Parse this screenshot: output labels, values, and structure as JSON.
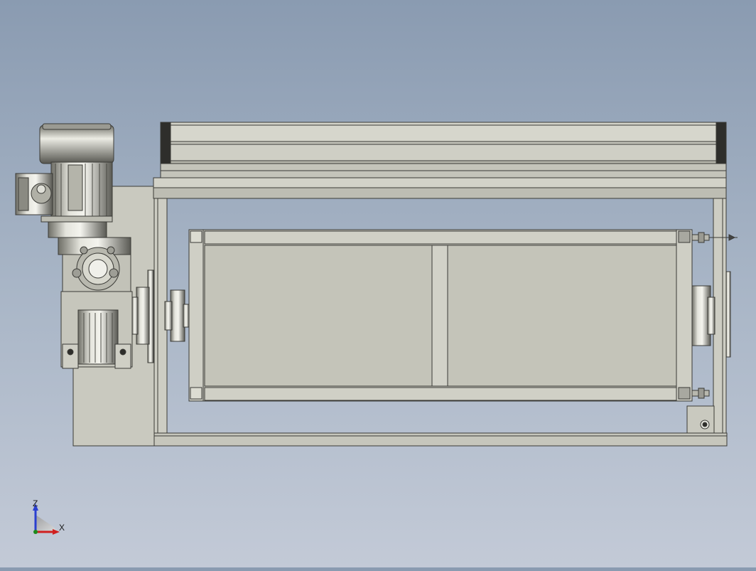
{
  "view": {
    "background_top": "#8a9bb1",
    "background_bottom": "#c3cad7",
    "part_fill": "#c8c8bd",
    "part_edge": "#3a3a36"
  },
  "triad": {
    "z_label": "Z",
    "x_label": "X",
    "z_color": "#2a3fd0",
    "x_color": "#d02020"
  }
}
